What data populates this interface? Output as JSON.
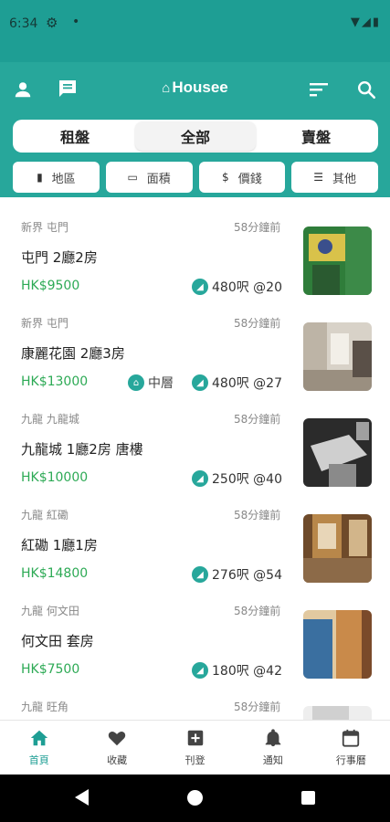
{
  "status_bar": {
    "time": "6:34"
  },
  "app_bar": {
    "brand": "Housee"
  },
  "segments": [
    {
      "label": "租盤",
      "active": false
    },
    {
      "label": "全部",
      "active": true
    },
    {
      "label": "賣盤",
      "active": false
    }
  ],
  "filters": [
    {
      "icon": "map-icon",
      "label": "地區"
    },
    {
      "icon": "area-icon",
      "label": "面積"
    },
    {
      "icon": "dollar-icon",
      "label": "價錢"
    },
    {
      "icon": "lines-icon",
      "label": "其他"
    }
  ],
  "listings": [
    {
      "area": "新界 屯門",
      "time": "58分鐘前",
      "title": "屯門 2廳2房",
      "price": "HK$9500",
      "floor": "",
      "size": "480呎 @20",
      "thumb_colors": [
        "#2f7d3a",
        "#d9c24a",
        "#3a4f8c"
      ]
    },
    {
      "area": "新界 屯門",
      "time": "58分鐘前",
      "title": "康麗花園 2廳3房",
      "price": "HK$13000",
      "floor": "中層",
      "size": "480呎 @27",
      "thumb_colors": [
        "#d8d2c8",
        "#9a8f80",
        "#5a5048"
      ]
    },
    {
      "area": "九龍 九龍城",
      "time": "58分鐘前",
      "title": "九龍城 1廳2房 唐樓",
      "price": "HK$10000",
      "floor": "",
      "size": "250呎 @40",
      "thumb_colors": [
        "#2b2b2b",
        "#8a8a8a",
        "#cfcfcf"
      ]
    },
    {
      "area": "九龍 紅磡",
      "time": "58分鐘前",
      "title": "紅磡 1廳1房",
      "price": "HK$14800",
      "floor": "",
      "size": "276呎 @54",
      "thumb_colors": [
        "#b8874a",
        "#6e4a2a",
        "#e8d6b8"
      ]
    },
    {
      "area": "九龍 何文田",
      "time": "58分鐘前",
      "title": "何文田 套房",
      "price": "HK$7500",
      "floor": "",
      "size": "180呎 @42",
      "thumb_colors": [
        "#c98a4a",
        "#3a6fa0",
        "#e2c9a0"
      ]
    },
    {
      "area": "九龍 旺角",
      "time": "58分鐘前",
      "title": "",
      "price": "",
      "floor": "",
      "size": "",
      "thumb_colors": [
        "#d0d0d0",
        "#a8a8a8",
        "#eeeeee"
      ]
    }
  ],
  "bottom_nav": [
    {
      "icon": "home-icon",
      "label": "首頁",
      "active": true
    },
    {
      "icon": "heart-icon",
      "label": "收藏",
      "active": false
    },
    {
      "icon": "plus-box-icon",
      "label": "刊登",
      "active": false
    },
    {
      "icon": "bell-icon",
      "label": "通知",
      "active": false
    },
    {
      "icon": "calendar-icon",
      "label": "行事曆",
      "active": false
    }
  ],
  "colors": {
    "primary": "#27a79b",
    "status_bar": "#1e9e94",
    "price": "#2daa55"
  }
}
